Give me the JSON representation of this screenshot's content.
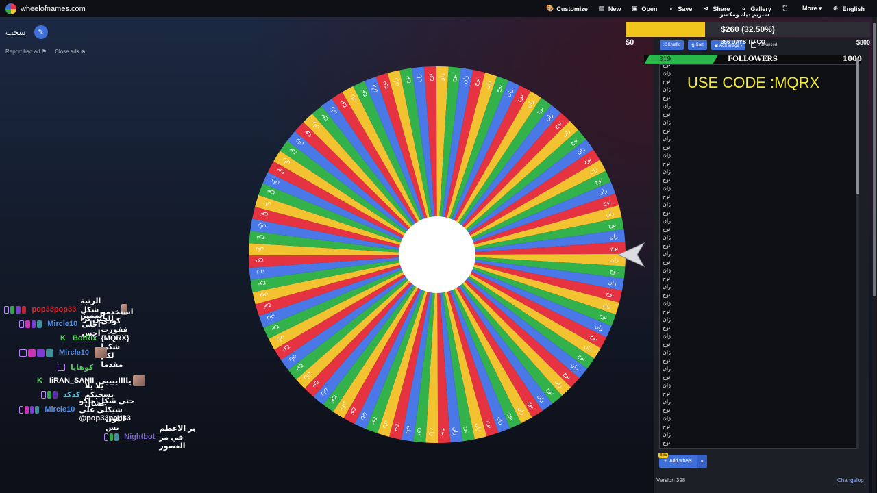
{
  "app": {
    "site": "wheelofnames.com"
  },
  "nav": [
    {
      "label": "Customize",
      "icon": "palette-icon",
      "glyph": "🎨"
    },
    {
      "label": "New",
      "icon": "new-file-icon",
      "glyph": "▤"
    },
    {
      "label": "Open",
      "icon": "folder-icon",
      "glyph": "▣"
    },
    {
      "label": "Save",
      "icon": "save-icon",
      "glyph": "▪"
    },
    {
      "label": "Share",
      "icon": "share-icon",
      "glyph": "⋖"
    },
    {
      "label": "Gallery",
      "icon": "search-icon",
      "glyph": "⌕"
    },
    {
      "label": "",
      "icon": "fullscreen-icon",
      "glyph": "⛶"
    },
    {
      "label": "More ▾",
      "icon": "more-icon",
      "glyph": ""
    },
    {
      "label": "English",
      "icon": "globe-icon",
      "glyph": "⊕"
    }
  ],
  "wheel": {
    "title": "سحب",
    "segment_colors": [
      "#e53341",
      "#f2c230",
      "#33b24b",
      "#4a78e6"
    ],
    "entries": [
      "نوح",
      "زان"
    ]
  },
  "ads": {
    "report": "Report bad ad ⚑",
    "close": "Close ads ⊗"
  },
  "goal": {
    "top_text": "ستريم ديك ومكسر",
    "amount_text": "$260 (32.50%)",
    "start": "$0",
    "end": "$800",
    "days": "356 DAYS TO GO",
    "progress": 0.325
  },
  "panel": {
    "shuffle": "Shuffle",
    "sort": "Sort",
    "add_image": "Add image ▾",
    "advanced": "Advanced",
    "code_text": "USE CODE :MQRX",
    "beta": "Beta",
    "add_wheel": "Add wheel",
    "add_wheel_drop": "▾",
    "version": "Version 398",
    "changelog": "Changelog"
  },
  "followers": {
    "current": "319",
    "label": "FOLLOWERS",
    "target": "1000"
  },
  "chat": [
    {
      "badges": [
        "outline",
        "green",
        "purple",
        "red"
      ],
      "name": "pop33pop33",
      "name_color": "#e0272f",
      "message": "الرتبة شكل للحين ترا",
      "avatar": true
    },
    {
      "badges": [
        "outline",
        "pink",
        "purple",
        "teal"
      ],
      "name": "Mircle10",
      "name_color": "#4f8ee8",
      "message": "المميز احلى احس",
      "avatar": false
    },
    {
      "badges": [
        "k"
      ],
      "name": "BotRix",
      "name_color": "#52e052",
      "message": "استخدمو كودي ففورت {MQRX} شكرا لكم مقدما",
      "avatar": false
    },
    {
      "badges": [
        "outline",
        "pink",
        "purple",
        "teal"
      ],
      "name": "Mircle10",
      "name_color": "#4f8ee8",
      "message": "",
      "avatar": true
    },
    {
      "badges": [
        "outline"
      ],
      "name": "كوهايا",
      "name_color": "#52c55a",
      "message": "",
      "avatar": false
    },
    {
      "badges": [
        "k"
      ],
      "name": "IiRAN_SANII",
      "name_color": "#ffffff",
      "message": "يااااييييي",
      "avatar": true
    },
    {
      "badges": [
        "outline",
        "green",
        "gift"
      ],
      "name": "كدكد",
      "name_color": "#4fbfd8",
      "message": "يلا يلا يسحبكم عشان",
      "avatar": false
    },
    {
      "badges": [
        "outline",
        "pink",
        "purple",
        "teal"
      ],
      "name": "Mircle10",
      "name_color": "#4f8ee8",
      "message": "حتى شكل ماكو شيكلي على @pop33pop33",
      "avatar": false
    },
    {
      "badges": [],
      "name": "",
      "name_color": "#ffffff",
      "message": "اللون بس",
      "avatar": false
    },
    {
      "badges": [
        "outline",
        "green",
        "teal"
      ],
      "name": "Nightbot",
      "name_color": "#7b64c4",
      "message": "بر الاعظم في مر العصور",
      "avatar": false
    }
  ]
}
